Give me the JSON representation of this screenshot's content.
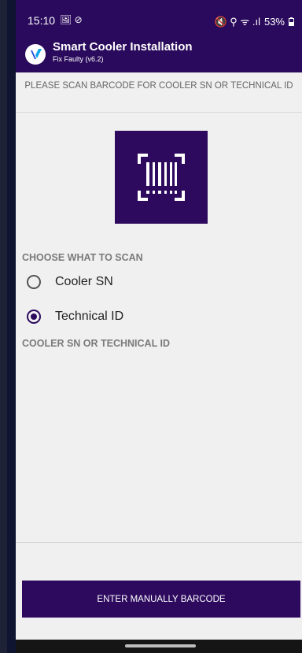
{
  "status_bar": {
    "time": "15:10",
    "left_icons": "🖼 ⊘",
    "right_icons": "🔇 ⚲ ᯤ .ıl",
    "battery": "53%"
  },
  "app_bar": {
    "title": "Smart Cooler Installation",
    "subtitle": "Fix Faulty (v6.2)"
  },
  "instruction": "PLEASE SCAN BARCODE FOR COOLER SN OR TECHNICAL ID",
  "scan_button_icon": "barcode-scan-icon",
  "choose": {
    "label": "CHOOSE WHAT TO SCAN",
    "options": [
      {
        "label": "Cooler SN",
        "selected": false
      },
      {
        "label": "Technical ID",
        "selected": true
      }
    ]
  },
  "field_label": "COOLER SN OR TECHNICAL ID",
  "manual_button": "ENTER MANUALLY BARCODE",
  "colors": {
    "primary": "#2d0a5e",
    "background": "#f0f0f0"
  }
}
